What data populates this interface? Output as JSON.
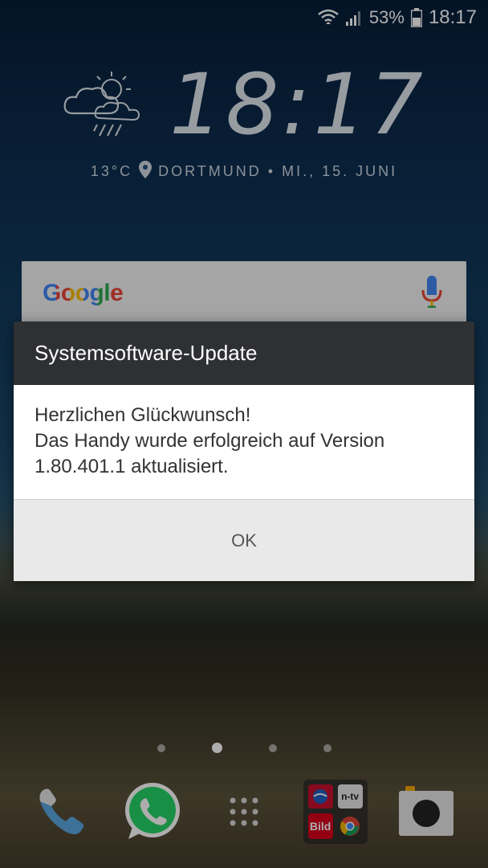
{
  "status_bar": {
    "battery_percent": "53%",
    "time": "18:17",
    "icons": [
      "wifi-icon",
      "signal-icon",
      "battery-icon"
    ]
  },
  "clock_widget": {
    "time": "18:17",
    "temperature": "13°C",
    "location": "DORTMUND",
    "separator": "•",
    "date": "MI., 15. JUNI",
    "weather_icon": "rain-cloud-icon"
  },
  "search": {
    "logo_text": "Google",
    "icons": [
      "mic-icon"
    ]
  },
  "dialog": {
    "title": "Systemsoftware-Update",
    "line1": "Herzlichen Glückwunsch!",
    "line2": "Das Handy wurde erfolgreich auf Version",
    "line3": "1.80.401.1 aktualisiert.",
    "ok_label": "OK"
  },
  "home": {
    "page_count": 4,
    "active_page": 2
  },
  "dock": {
    "icons": [
      "phone-icon",
      "whatsapp-icon",
      "app-drawer-icon",
      "app-folder-icon",
      "camera-icon"
    ],
    "folder_labels": {
      "ntv": "n-tv",
      "bild": "Bild"
    }
  },
  "colors": {
    "dialog_header": "#2f3033",
    "dialog_footer": "#e9e9e9",
    "whatsapp_green": "#25d366"
  }
}
